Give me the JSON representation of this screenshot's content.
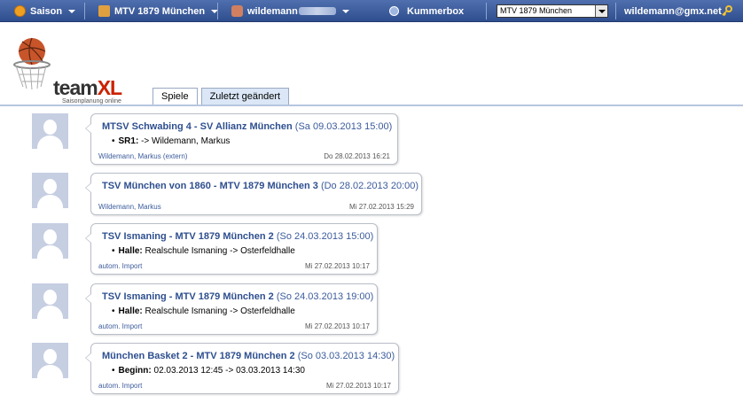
{
  "nav": {
    "season_label": "Saison",
    "team_label": "MTV 1879 München",
    "user_label": "wildemann",
    "kummerbox_label": "Kummerbox",
    "team_select_value": "MTV 1879 München",
    "email": "wildemann@gmx.net"
  },
  "logo": {
    "word1": "team",
    "word2": "XL",
    "tagline": "Saisonplanung online"
  },
  "tabs": [
    "Spiele",
    "Zuletzt geändert"
  ],
  "feed": [
    {
      "teams": "MTSV Schwabing 4 - SV Allianz München",
      "when": "(Sa 09.03.2013 15:00)",
      "detail_key": "SR1:",
      "detail_val": "-> Wildemann, Markus",
      "author": "Wildemann, Markus (extern)",
      "stamp": "Do 28.02.2013 16:21"
    },
    {
      "teams": "TSV München von 1860 - MTV 1879 München 3",
      "when": "(Do 28.02.2013 20:00)",
      "detail_key": "",
      "detail_val": "",
      "author": "Wildemann, Markus",
      "stamp": "Mi 27.02.2013 15:29"
    },
    {
      "teams": "TSV Ismaning - MTV 1879 München 2",
      "when": "(So 24.03.2013 15:00)",
      "detail_key": "Halle:",
      "detail_val": "Realschule Ismaning -> Osterfeldhalle",
      "author": "autom. Import",
      "stamp": "Mi 27.02.2013 10:17"
    },
    {
      "teams": "TSV Ismaning - MTV 1879 München 2",
      "when": "(So 24.03.2013 19:00)",
      "detail_key": "Halle:",
      "detail_val": "Realschule Ismaning -> Osterfeldhalle",
      "author": "autom. Import",
      "stamp": "Mi 27.02.2013 10:17"
    },
    {
      "teams": "München Basket 2 - MTV 1879 München 2",
      "when": "(So 03.03.2013 14:30)",
      "detail_key": "Beginn:",
      "detail_val": "02.03.2013 12:45 -> 03.03.2013 14:30",
      "author": "autom. Import",
      "stamp": "Mi 27.02.2013 10:17"
    }
  ]
}
